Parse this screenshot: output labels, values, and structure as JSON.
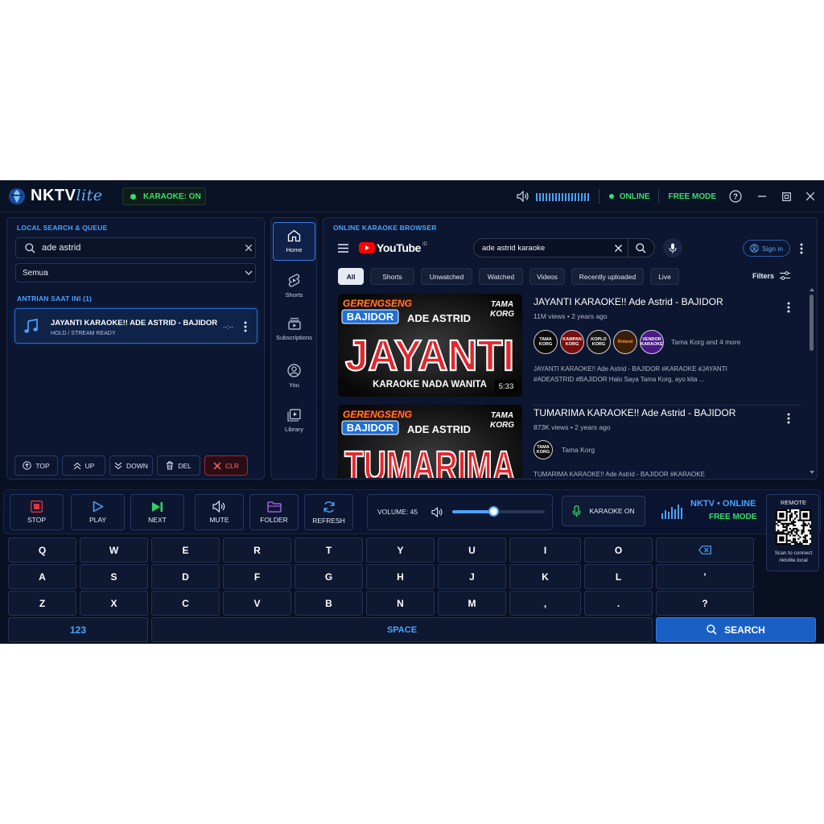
{
  "app": {
    "logo_main": "NKTV",
    "logo_sub": "lite",
    "karaoke_status": "KARAOKE: ON",
    "online_status": "ONLINE",
    "mode": "FREE MODE",
    "help_glyph": "?"
  },
  "left_panel": {
    "title": "LOCAL SEARCH & QUEUE",
    "search_value": "ade astrid",
    "category_selected": "Semua",
    "queue_title": "ANTRIAN SAAT INI (1)",
    "queue": [
      {
        "title": "JAYANTI KARAOKE!! ADE ASTRID - BAJIDOR",
        "status": "HOLD / STREAM READY",
        "time": "--:--"
      }
    ],
    "buttons": {
      "top": "TOP",
      "up": "UP",
      "down": "DOWN",
      "del": "DEL",
      "clr": "CLR"
    }
  },
  "nav": {
    "items": [
      {
        "label": "Home",
        "icon": "home-icon"
      },
      {
        "label": "Shorts",
        "icon": "shorts-icon"
      },
      {
        "label": "Subscriptions",
        "icon": "subscriptions-icon"
      },
      {
        "label": "You",
        "icon": "you-icon"
      },
      {
        "label": "Library",
        "icon": "library-icon"
      }
    ]
  },
  "browser": {
    "title": "ONLINE KARAOKE BROWSER",
    "yt_logo": "YouTube",
    "yt_region": "ID",
    "search_value": "ade astrid karaoke",
    "sign_in": "Sign in",
    "filters_label": "Filters",
    "chips": [
      "All",
      "Shorts",
      "Unwatched",
      "Watched",
      "Videos",
      "Recently uploaded",
      "Live"
    ],
    "videos": [
      {
        "title": "JAYANTI KARAOKE!! Ade Astrid - BAJIDOR",
        "meta": "11M views • 2 years ago",
        "channel": "Tama Korg and 4 more",
        "desc_1": "JAYANTI KARAOKE!! Ade Astrid - BAJIDOR #KARAOKE #JAYANTI",
        "desc_2": "#ADEASTRID #BAJIDOR Halo Saya Tama Korg, ayo kita ...",
        "duration": "5:33",
        "thumb_brand": "GERENGSENG",
        "thumb_genre": "BAJIDOR",
        "thumb_artist": "ADE ASTRID",
        "thumb_song": "JAYANTI",
        "thumb_sub": "KARAOKE NADA WANITA",
        "thumb_label_1": "TAMA",
        "thumb_label_2": "KORG",
        "avatars": [
          "TAMA KORG",
          "KAMPAN KORG",
          "KOPLO KORG",
          "Roland",
          "VENDOR KARAOKE"
        ]
      },
      {
        "title": "TUMARIMA KARAOKE!! Ade Astrid - BAJIDOR",
        "meta": "873K views • 2 years ago",
        "channel": "Tama Korg",
        "desc_1": "TUMARIMA KARAOKE!! Ade Astrid - BAJIDOR #KARAOKE",
        "thumb_brand": "GERENGSENG",
        "thumb_genre": "BAJIDOR",
        "thumb_artist": "ADE ASTRID",
        "thumb_song": "TUMARIMA",
        "thumb_label_1": "TAMA",
        "thumb_label_2": "KORG",
        "avatars": [
          "TAMA KORG"
        ]
      }
    ]
  },
  "controls": {
    "stop": "STOP",
    "play": "PLAY",
    "next": "NEXT",
    "mute": "MUTE",
    "folder": "FOLDER",
    "refresh": "REFRESH",
    "volume_label": "VOLUME: 45",
    "volume_value": 45,
    "karaoke_on": "KARAOKE ON",
    "status_line1": "NKTV • ONLINE",
    "status_line2": "FREE MODE",
    "remote_title": "REMOTE",
    "remote_caption_1": "Scan to connect",
    "remote_caption_2": "nktvlite.local"
  },
  "keyboard": {
    "row1": [
      "Q",
      "W",
      "E",
      "R",
      "T",
      "Y",
      "U",
      "I",
      "O"
    ],
    "row2": [
      "A",
      "S",
      "D",
      "F",
      "G",
      "H",
      "J",
      "K",
      "L",
      "'"
    ],
    "row3": [
      "Z",
      "X",
      "C",
      "V",
      "B",
      "N",
      "M",
      ",",
      ".",
      "?"
    ],
    "numeric": "123",
    "space": "SPACE",
    "search": "SEARCH"
  },
  "colors": {
    "accent": "#4aa3ff",
    "green": "#34e06b",
    "danger": "#e5333d",
    "search_button": "#1a5fc4"
  }
}
